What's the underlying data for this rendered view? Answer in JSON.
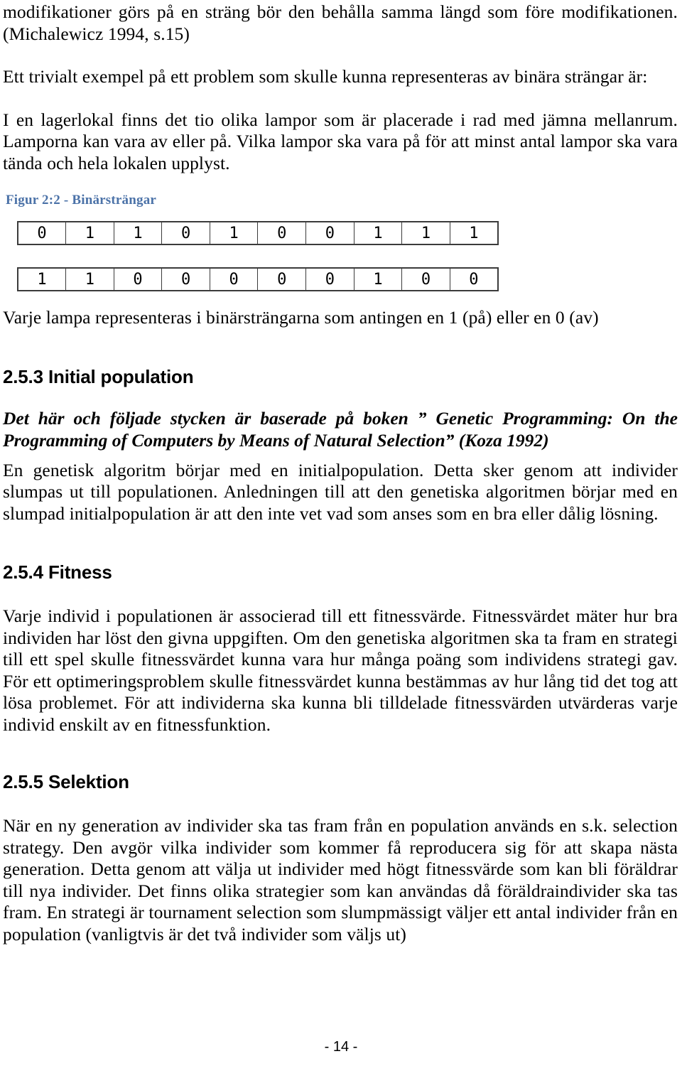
{
  "document": {
    "intro_paragraph_1": "modifikationer görs på en sträng bör den behålla samma längd som före modifikationen. (Michalewicz 1994, s.15)",
    "intro_paragraph_2": "Ett trivialt exempel på ett problem som skulle kunna representeras av binära strängar är:",
    "intro_paragraph_3": "I en lagerlokal finns det tio olika lampor som är placerade i rad med jämna mellanrum. Lamporna kan vara av eller på. Vilka lampor ska vara på för att minst antal lampor ska vara tända och hela lokalen upplyst.",
    "figure": {
      "caption": "Figur 2:2 - Binärsträngar",
      "caption_color": "#4b72a8",
      "rows": [
        [
          "0",
          "1",
          "1",
          "0",
          "1",
          "0",
          "0",
          "1",
          "1",
          "1"
        ],
        [
          "1",
          "1",
          "0",
          "0",
          "0",
          "0",
          "0",
          "1",
          "0",
          "0"
        ]
      ],
      "description": "Varje lampa representeras i binärsträngarna som antingen en 1 (på) eller en 0 (av)"
    },
    "sections": [
      {
        "number": "2.5.3",
        "title": "Initial population",
        "quote": "Det här och följade stycken är baserade på boken ” Genetic Programming: On the Programming of Computers by Means of Natural Selection” (Koza 1992)",
        "body": "En genetisk algoritm börjar med en initialpopulation. Detta sker genom att individer slumpas ut till populationen. Anledningen till att den genetiska algoritmen börjar med en slumpad initialpopulation är att den inte vet vad som anses som en bra eller dålig lösning."
      },
      {
        "number": "2.5.4",
        "title": "Fitness",
        "body": "Varje individ i populationen är associerad till ett fitnessvärde. Fitnessvärdet mäter hur bra individen har löst den givna uppgiften. Om den genetiska algoritmen ska ta fram en strategi till ett spel skulle fitnessvärdet kunna vara hur många poäng som individens strategi gav. För ett optimeringsproblem skulle fitnessvärdet kunna bestämmas av hur lång tid det tog att lösa problemet. För att individerna ska kunna bli tilldelade fitnessvärden utvärderas varje individ enskilt av en fitnessfunktion."
      },
      {
        "number": "2.5.5",
        "title": "Selektion",
        "body": "När en ny generation av individer ska tas fram från en population används en s.k. selection strategy. Den avgör vilka individer som kommer få reproducera sig för att skapa nästa generation. Detta genom att välja ut individer med högt fitnessvärde som kan bli föräldrar till nya individer. Det finns olika strategier som kan användas då föräldraindivider ska tas fram. En strategi är tournament selection som slumpmässigt väljer ett antal individer från en population (vanligtvis är det två individer som väljs ut)"
      }
    ],
    "footer": {
      "page_label": "- 14 -"
    }
  }
}
